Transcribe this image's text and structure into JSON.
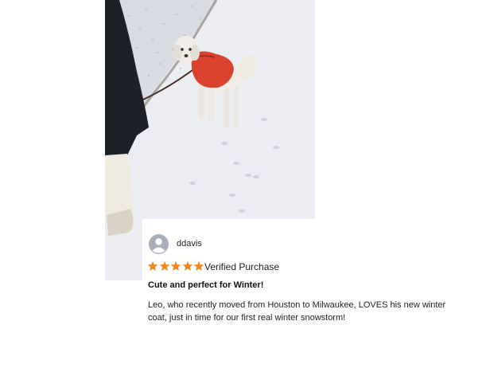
{
  "photo": {
    "subject": "dog-in-red-winter-coat-on-snowy-path"
  },
  "review": {
    "avatar": {
      "icon": "user-avatar-icon",
      "color": "#a9b0b9"
    },
    "username": "ddavis",
    "rating": 5,
    "rating_max": 5,
    "star_color": "#f08a1e",
    "badge": "Verified Purchase",
    "title": "Cute and perfect for Winter!",
    "body": "Leo, who recently moved from Houston to Milwaukee, LOVES his new winter coat, just in time for our first real winter snowstorm!"
  }
}
